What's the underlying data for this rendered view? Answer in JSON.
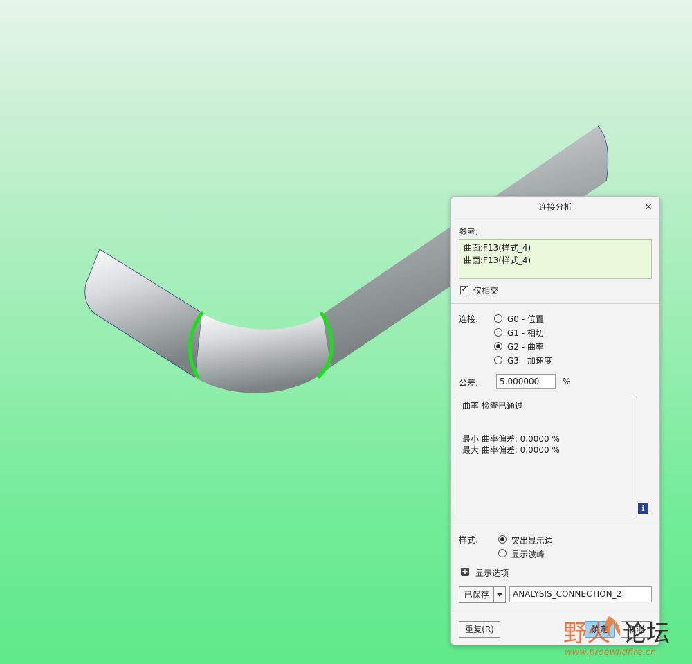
{
  "dialog": {
    "title": "连接分析",
    "reference_label": "参考:",
    "references": [
      "曲面:F13(样式_4)",
      "曲面:F13(样式_4)"
    ],
    "intersect_only_label": "仅相交",
    "intersect_only_checked": true,
    "connection_label": "连接:",
    "connection_options": [
      "G0 - 位置",
      "G1 - 相切",
      "G2 - 曲率",
      "G3 - 加速度"
    ],
    "connection_selected": "G2 - 曲率",
    "tolerance_label": "公差:",
    "tolerance_value": "5.000000",
    "tolerance_unit": "%",
    "results": {
      "line1": "曲率 检查已通过",
      "line2": "最小 曲率偏差: 0.0000 %",
      "line3": "最大 曲率偏差: 0.0000 %"
    },
    "style_label": "样式:",
    "style_options": [
      "突出显示边",
      "显示波峰"
    ],
    "style_selected": "突出显示边",
    "display_options_label": "显示选项",
    "saved_label": "已保存",
    "analysis_name": "ANALYSIS_CONNECTION_2",
    "repeat_button": "重复(R)",
    "ok_button": "确定",
    "cancel_button": "取消"
  },
  "watermark": {
    "brand": "野火论坛",
    "url": "www.proewildfire.cn"
  },
  "colors": {
    "highlight_edge": "#19e019",
    "ref_box_bg": "#eaf8dc",
    "info_icon": "#27418a",
    "ok_button": "#9bd4f2"
  }
}
